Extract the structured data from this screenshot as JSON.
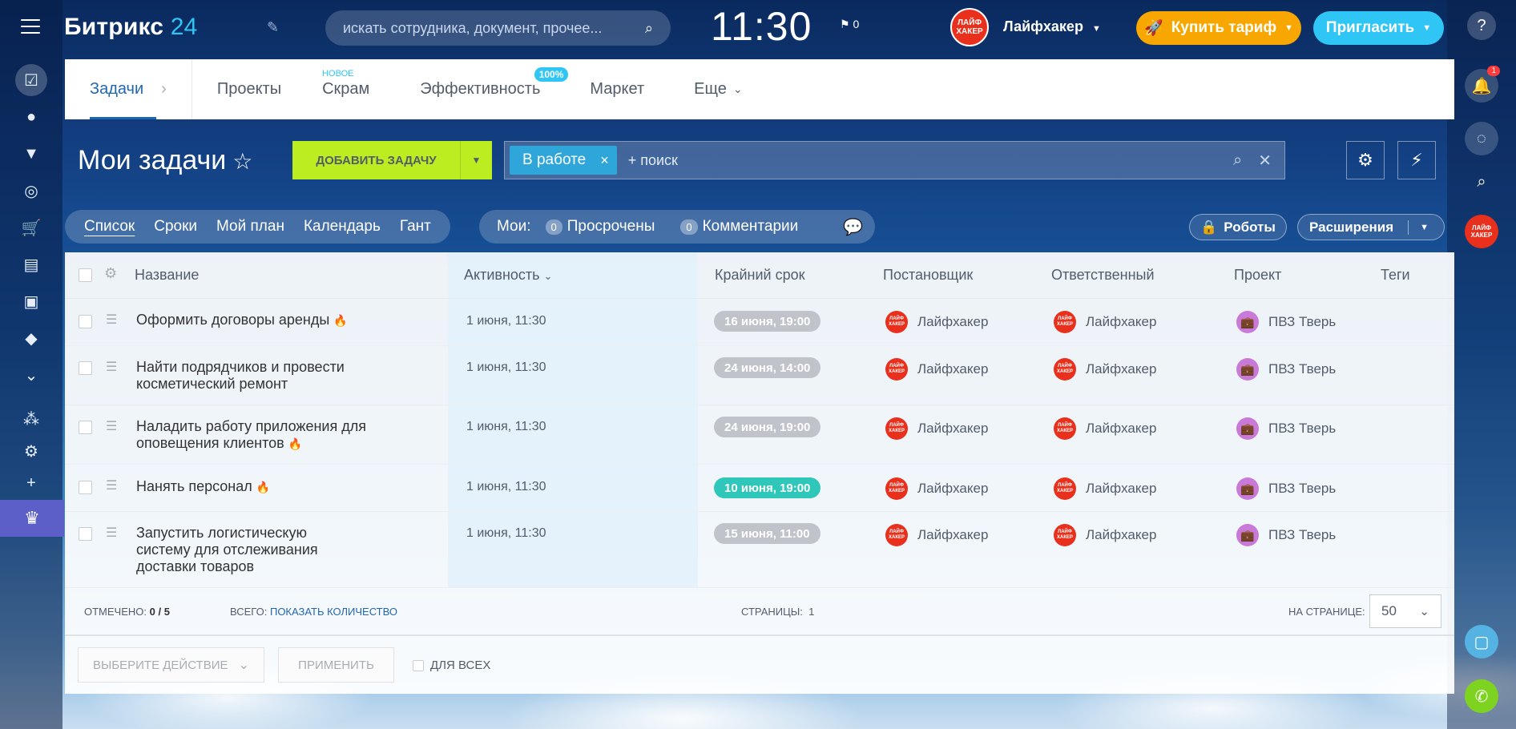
{
  "header": {
    "logo_text": "Битрикс",
    "logo_num": "24",
    "search_placeholder": "искать сотрудника, документ, прочее...",
    "clock": "11:30",
    "flag_count": "0",
    "user_avatar_text": "ЛАЙФ ХАКЕР",
    "user_name": "Лайфхакер",
    "buy_label": "Купить тариф",
    "invite_label": "Пригласить"
  },
  "topnav": {
    "items": [
      {
        "label": "Задачи"
      },
      {
        "label": "Проекты"
      },
      {
        "label": "Скрам",
        "tag": "НОВОЕ"
      },
      {
        "label": "Эффективность",
        "badge": "100%"
      },
      {
        "label": "Маркет"
      },
      {
        "label": "Еще"
      }
    ]
  },
  "page": {
    "title": "Мои задачи",
    "add_task": "ДОБАВИТЬ ЗАДАЧУ",
    "filter_chip": "В работе",
    "filter_placeholder": "+ поиск"
  },
  "views": [
    "Список",
    "Сроки",
    "Мой план",
    "Календарь",
    "Гант"
  ],
  "mine": {
    "label": "Мои:",
    "overdue_count": "0",
    "overdue_label": "Просрочены",
    "comments_count": "0",
    "comments_label": "Комментарии"
  },
  "toolbar": {
    "robots": "Роботы",
    "extensions": "Расширения"
  },
  "columns": {
    "name": "Название",
    "activity": "Активность",
    "deadline": "Крайний срок",
    "creator": "Постановщик",
    "responsible": "Ответственный",
    "project": "Проект",
    "tags": "Теги"
  },
  "tasks": [
    {
      "title": "Оформить договоры аренды",
      "activity": "1 июня, 11:30",
      "deadline": "16 июня, 19:00",
      "creator": "Лайфхакер",
      "responsible": "Лайфхакер",
      "project": "ПВЗ Тверь"
    },
    {
      "title": "Найти подрядчиков и провести косметический ремонт",
      "activity": "1 июня, 11:30",
      "deadline": "24 июня, 14:00",
      "creator": "Лайфхакер",
      "responsible": "Лайфхакер",
      "project": "ПВЗ Тверь"
    },
    {
      "title": "Наладить работу приложения для оповещения клиентов",
      "activity": "1 июня, 11:30",
      "deadline": "24 июня, 19:00",
      "creator": "Лайфхакер",
      "responsible": "Лайфхакер",
      "project": "ПВЗ Тверь"
    },
    {
      "title": "Нанять персонал",
      "activity": "1 июня, 11:30",
      "deadline": "10 июня, 19:00",
      "creator": "Лайфхакер",
      "responsible": "Лайфхакер",
      "project": "ПВЗ Тверь"
    },
    {
      "title": "Запустить логистическую систему для отслеживания доставки товаров",
      "activity": "1 июня, 11:30",
      "deadline": "15 июня, 11:00",
      "creator": "Лайфхакер",
      "responsible": "Лайфхакер",
      "project": "ПВЗ Тверь"
    }
  ],
  "footer": {
    "checked_label": "ОТМЕЧЕНО:",
    "checked_value": "0 / 5",
    "total_label": "ВСЕГО:",
    "total_link": "ПОКАЗАТЬ КОЛИЧЕСТВО",
    "pages_label": "СТРАНИЦЫ:",
    "pages_value": "1",
    "per_page_label": "НА СТРАНИЦЕ:",
    "per_page_value": "50"
  },
  "actions": {
    "select_action": "ВЫБЕРИТЕ ДЕЙСТВИЕ",
    "apply": "ПРИМЕНИТЬ",
    "for_all": "ДЛЯ ВСЕХ"
  },
  "notifications": {
    "count": "1"
  },
  "colors": {
    "accent": "#2fc6f6",
    "add_button": "#bbed21",
    "buy_button": "#f7a700",
    "overdue_soon": "#2fc7b9"
  }
}
